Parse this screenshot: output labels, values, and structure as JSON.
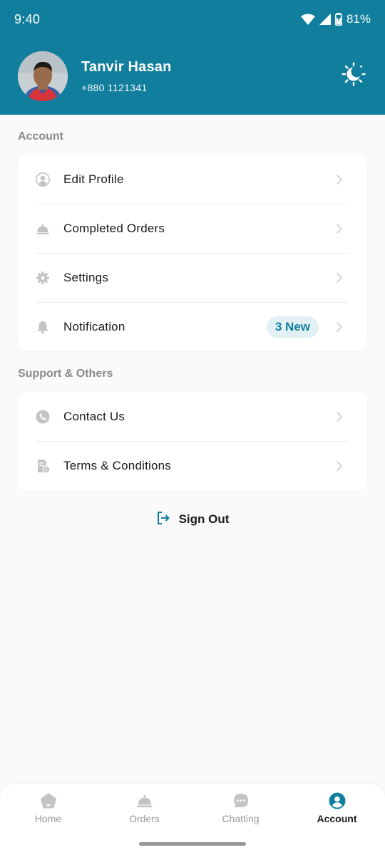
{
  "status_bar": {
    "time": "9:40",
    "battery": "81%"
  },
  "profile": {
    "name": "Tanvir Hasan",
    "phone": "+880 1121341"
  },
  "account_section": {
    "title": "Account",
    "items": [
      {
        "label": "Edit Profile",
        "icon": "user-circle-icon"
      },
      {
        "label": "Completed Orders",
        "icon": "cloche-icon"
      },
      {
        "label": "Settings",
        "icon": "gear-icon"
      },
      {
        "label": "Notification",
        "icon": "bell-icon",
        "badge": "3 New"
      }
    ]
  },
  "support_section": {
    "title": "Support & Others",
    "items": [
      {
        "label": "Contact Us",
        "icon": "phone-icon"
      },
      {
        "label": "Terms & Conditions",
        "icon": "document-info-icon"
      }
    ]
  },
  "sign_out": {
    "label": "Sign Out",
    "icon": "logout-icon"
  },
  "bottom_nav": {
    "items": [
      {
        "label": "Home",
        "icon": "home-icon"
      },
      {
        "label": "Orders",
        "icon": "cloche-icon"
      },
      {
        "label": "Chatting",
        "icon": "chat-icon"
      },
      {
        "label": "Account",
        "icon": "account-icon",
        "active": true
      }
    ]
  },
  "colors": {
    "primary": "#107e9c",
    "background": "#fafafa",
    "badge_bg": "#e1f0f4",
    "icon_muted": "#c4c4c4"
  }
}
